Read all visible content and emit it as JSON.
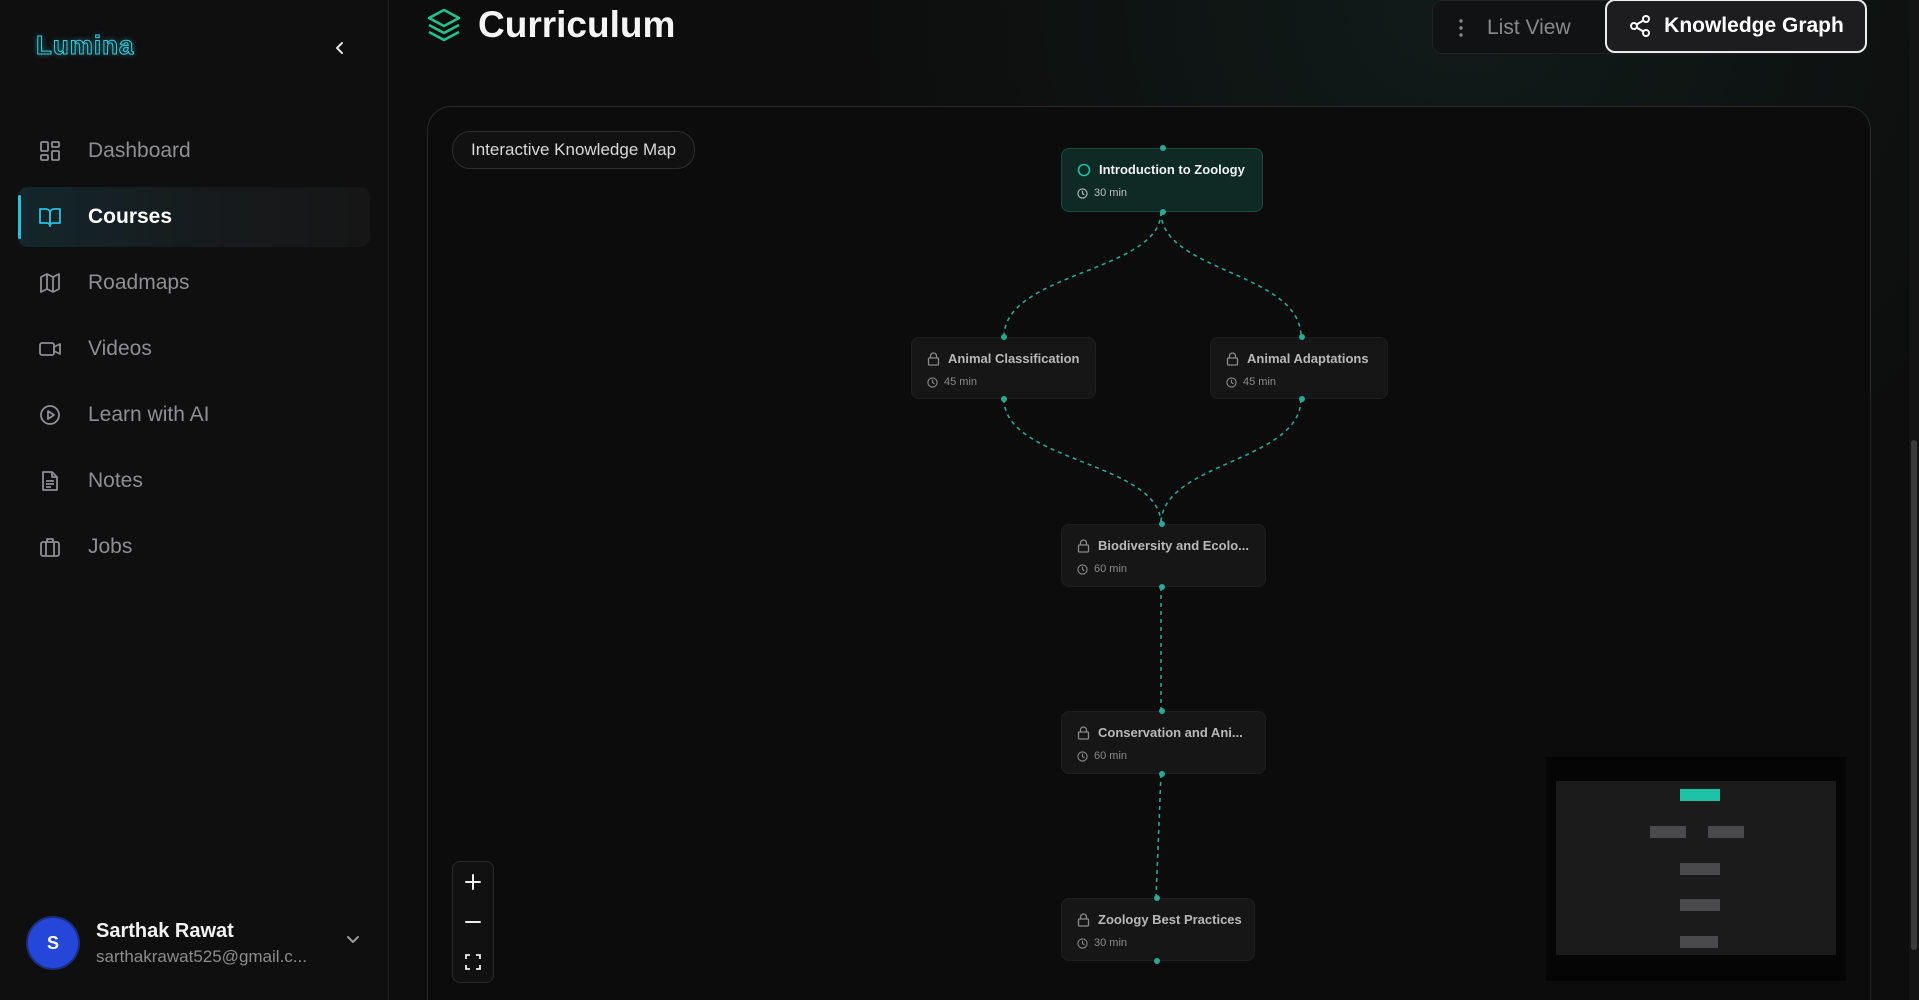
{
  "app": {
    "logo": "Lumina"
  },
  "sidebar": {
    "items": [
      {
        "label": "Dashboard",
        "icon": "dashboard-icon",
        "active": false
      },
      {
        "label": "Courses",
        "icon": "book-open-icon",
        "active": true
      },
      {
        "label": "Roadmaps",
        "icon": "map-icon",
        "active": false
      },
      {
        "label": "Videos",
        "icon": "video-icon",
        "active": false
      },
      {
        "label": "Learn with AI",
        "icon": "play-circle-icon",
        "active": false
      },
      {
        "label": "Notes",
        "icon": "file-text-icon",
        "active": false
      },
      {
        "label": "Jobs",
        "icon": "briefcase-icon",
        "active": false
      }
    ],
    "user": {
      "initial": "S",
      "name": "Sarthak Rawat",
      "email": "sarthakrawat525@gmail.c..."
    }
  },
  "header": {
    "title": "Curriculum",
    "list_view_label": "List View",
    "graph_view_label": "Knowledge Graph"
  },
  "canvas": {
    "label": "Interactive Knowledge Map",
    "nodes": [
      {
        "title": "Introduction to Zoology",
        "duration": "30 min",
        "status": "current"
      },
      {
        "title": "Animal Classification",
        "duration": "45 min",
        "status": "locked"
      },
      {
        "title": "Animal Adaptations",
        "duration": "45 min",
        "status": "locked"
      },
      {
        "title": "Biodiversity and Ecolo...",
        "duration": "60 min",
        "status": "locked"
      },
      {
        "title": "Conservation and Ani...",
        "duration": "60 min",
        "status": "locked"
      },
      {
        "title": "Zoology Best Practices",
        "duration": "30 min",
        "status": "locked"
      }
    ]
  },
  "colors": {
    "accent": "#27c0e0",
    "edge": "#2aa894",
    "current_node": "#0f2a25",
    "avatar": "#2447d9"
  }
}
